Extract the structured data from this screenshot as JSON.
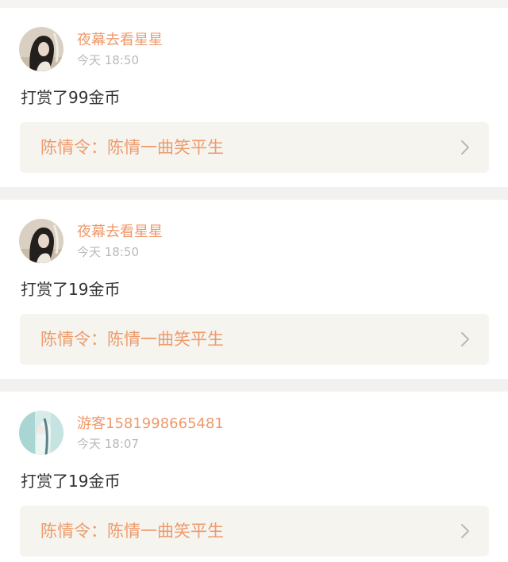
{
  "feed": {
    "items": [
      {
        "user": "夜幕去看星星",
        "time": "今天 18:50",
        "action": "打赏了99金币",
        "book": "陈情令：陈情一曲笑平生",
        "avatar": "dark-hair-avatar"
      },
      {
        "user": "夜幕去看星星",
        "time": "今天 18:50",
        "action": "打赏了19金币",
        "book": "陈情令：陈情一曲笑平生",
        "avatar": "dark-hair-avatar"
      },
      {
        "user": "游客1581998665481",
        "time": "今天 18:07",
        "action": "打赏了19金币",
        "book": "陈情令：陈情一曲笑平生",
        "avatar": "light-blue-avatar"
      }
    ]
  },
  "colors": {
    "accent": "#ee9a6b",
    "muted": "#b9b9b9",
    "body_text": "#333333",
    "link_bg": "#f5f4ef",
    "page_bg": "#f3f1ef"
  }
}
